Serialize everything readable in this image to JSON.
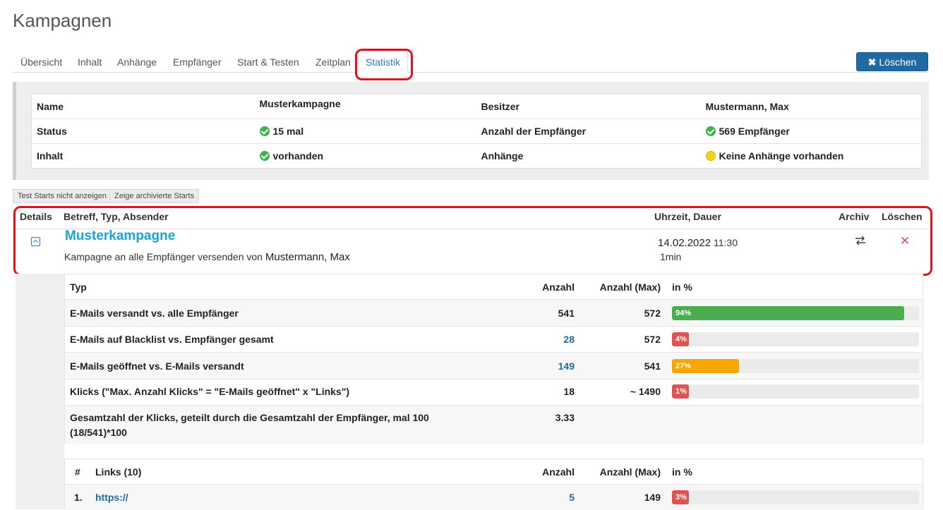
{
  "page": {
    "title": "Kampagnen"
  },
  "tabs": [
    {
      "label": "Übersicht"
    },
    {
      "label": "Inhalt"
    },
    {
      "label": "Anhänge"
    },
    {
      "label": "Empfänger"
    },
    {
      "label": "Start & Testen"
    },
    {
      "label": "Zeitplan"
    },
    {
      "label": "Statistik",
      "active": true
    }
  ],
  "delete_button": {
    "label": "Löschen"
  },
  "info": {
    "name_label": "Name",
    "name_value": "Musterkampagne",
    "owner_label": "Besitzer",
    "owner_value": "Mustermann, Max",
    "status_label": "Status",
    "status_value": "15 mal",
    "recipients_label": "Anzahl der Empfänger",
    "recipients_value": "569 Empfänger",
    "content_label": "Inhalt",
    "content_value": "vorhanden",
    "attachments_label": "Anhänge",
    "attachments_value": "Keine Anhänge vorhanden"
  },
  "filters": {
    "hide_test": "Test Starts nicht anzeigen",
    "show_archived": "Zeige archivierte Starts"
  },
  "starts": {
    "headers": {
      "details": "Details",
      "subject": "Betreff, Typ, Absender",
      "time": "Uhrzeit, Dauer",
      "archive": "Archiv",
      "delete": "Löschen"
    },
    "campaign": {
      "title": "Musterkampagne",
      "desc": "Kampagne an alle Empfänger versenden von",
      "sender": "Mustermann, Max",
      "date": "14.02.2022",
      "time": "11:30",
      "duration": "1min"
    }
  },
  "stats": {
    "headers": {
      "type": "Typ",
      "count": "Anzahl",
      "max": "Anzahl (Max)",
      "percent": "in %"
    },
    "rows": [
      {
        "label": "E-Mails versandt vs. alle Empfänger",
        "count": "541",
        "max": "572",
        "percent_label": "94%",
        "percent": 94,
        "color": "#4aae4e",
        "link": false
      },
      {
        "label": "E-Mails auf Blacklist vs. Empfänger gesamt",
        "count": "28",
        "max": "572",
        "percent_label": "4%",
        "percent": 4,
        "color": "#e05353",
        "link": true
      },
      {
        "label": "E-Mails geöffnet vs. E-Mails versandt",
        "count": "149",
        "max": "541",
        "percent_label": "27%",
        "percent": 27,
        "color": "#f7a700",
        "link": true
      },
      {
        "label": "Klicks (\"Max. Anzahl Klicks\" = \"E-Mails geöffnet\" x \"Links\")",
        "count": "18",
        "max": "~ 1490",
        "percent_label": "1%",
        "percent": 1,
        "color": "#e05353",
        "link": false
      }
    ],
    "total": {
      "line1": "Gesamtzahl der Klicks, geteilt durch die Gesamtzahl der Empfänger, mal 100",
      "line2": "(18/541)*100",
      "value": "3.33"
    }
  },
  "links": {
    "headers": {
      "num": "#",
      "links": "Links (10)",
      "count": "Anzahl",
      "max": "Anzahl (Max)",
      "percent": "in %"
    },
    "rows": [
      {
        "num": "1.",
        "url": "https://",
        "count": "5",
        "max": "149",
        "percent_label": "3%",
        "percent": 3
      }
    ]
  }
}
